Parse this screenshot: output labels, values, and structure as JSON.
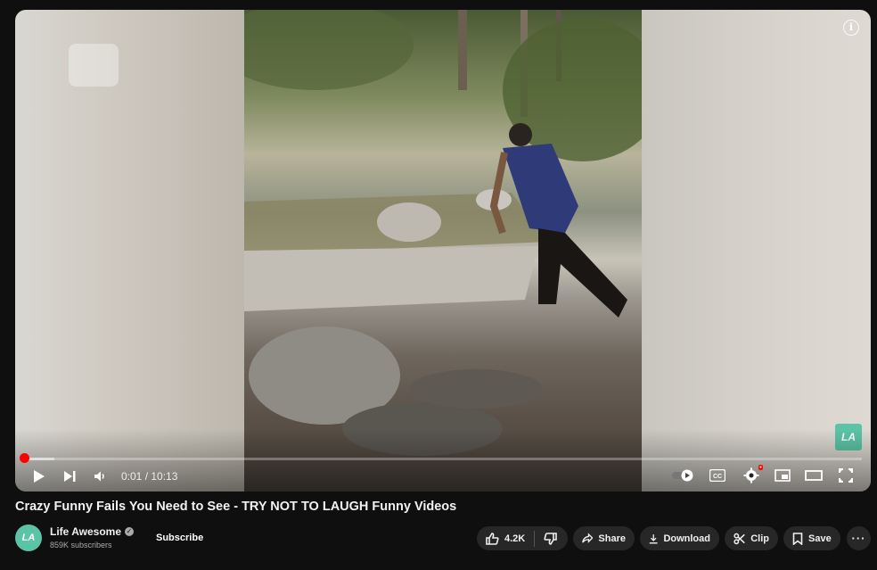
{
  "player": {
    "time_display": "0:01 / 10:13",
    "progress_fraction": 0.002,
    "watermark_text": "LA"
  },
  "video": {
    "title": "Crazy Funny Fails You Need to See - TRY NOT TO LAUGH Funny Videos"
  },
  "channel": {
    "name": "Life Awesome",
    "subscribers": "859K subscribers",
    "avatar_text": "LA",
    "subscribe_label": "Subscribe"
  },
  "actions": {
    "like_count": "4.2K",
    "share_label": "Share",
    "download_label": "Download",
    "clip_label": "Clip",
    "save_label": "Save"
  },
  "colors": {
    "background": "#0f0f0f",
    "progress": "#ff0000",
    "pill": "#272727",
    "brand": "#5cc4a6"
  }
}
